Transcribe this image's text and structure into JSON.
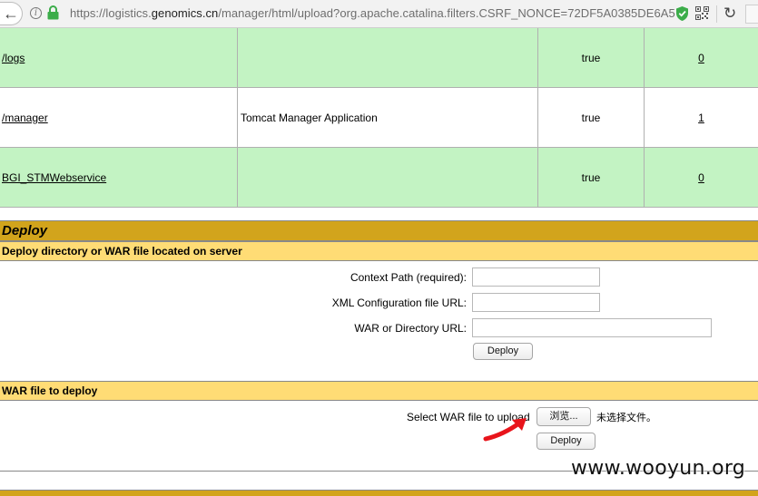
{
  "browser": {
    "url_prefix": "https://logistics.",
    "url_host": "genomics.cn",
    "url_path": "/manager/html/upload?org.apache.catalina.filters.CSRF_NONCE=72DF5A0385DE6A5",
    "back_glyph": "←",
    "reload_glyph": "↻",
    "info_glyph": "i"
  },
  "apps": [
    {
      "path": "/logs",
      "display_name": "",
      "running": "true",
      "sessions": "0"
    },
    {
      "path": "/manager",
      "display_name": "Tomcat Manager Application",
      "running": "true",
      "sessions": "1"
    },
    {
      "path": "BGI_STMWebservice",
      "display_name": "",
      "running": "true",
      "sessions": "0"
    }
  ],
  "deploy": {
    "title": "Deploy",
    "server_section_title": "Deploy directory or WAR file located on server",
    "context_path_label": "Context Path (required):",
    "xml_config_label": "XML Configuration file URL:",
    "war_dir_label": "WAR or Directory URL:",
    "context_path_value": "",
    "xml_config_value": "",
    "war_dir_value": "",
    "deploy_button": "Deploy",
    "war_section_title": "WAR file to deploy",
    "select_war_label": "Select WAR file to upload",
    "browse_button": "浏览...",
    "no_file_text": "未选择文件。",
    "war_deploy_button": "Deploy"
  },
  "watermark": "www.wooyun.org",
  "colors": {
    "row_green": "#c3f3c3",
    "deploy_header": "#d2a41c",
    "section_header": "#ffdc75",
    "annotation_arrow": "#e8141b",
    "shield_green": "#3cad4a"
  }
}
